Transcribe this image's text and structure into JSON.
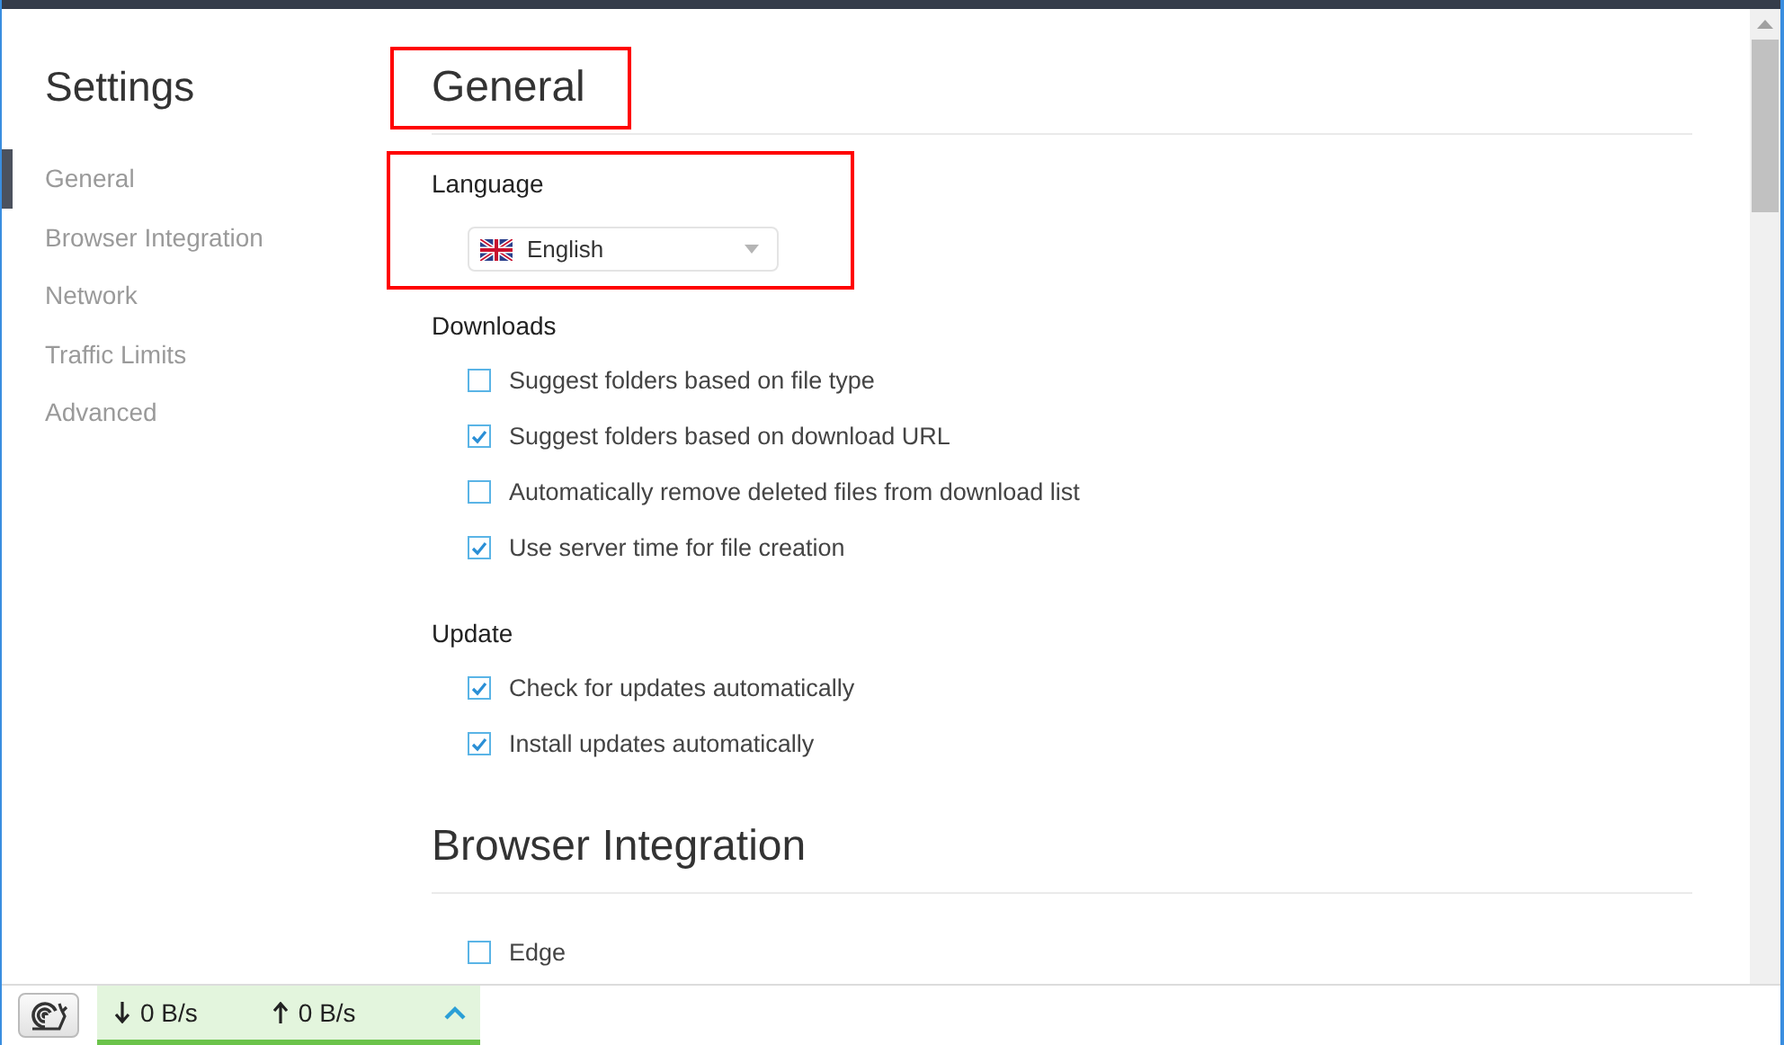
{
  "sidebar": {
    "title": "Settings",
    "items": [
      {
        "label": "General",
        "selected": true
      },
      {
        "label": "Browser Integration",
        "selected": false
      },
      {
        "label": "Network",
        "selected": false
      },
      {
        "label": "Traffic Limits",
        "selected": false
      },
      {
        "label": "Advanced",
        "selected": false
      }
    ]
  },
  "sections": [
    {
      "title": "General",
      "highlighted": true,
      "groups": [
        {
          "kind": "select",
          "label": "Language",
          "value": "English",
          "highlighted": true
        },
        {
          "kind": "checkboxes",
          "label": "Downloads",
          "highlighted": false,
          "options": [
            {
              "label": "Suggest folders based on file type",
              "checked": false
            },
            {
              "label": "Suggest folders based on download URL",
              "checked": true
            },
            {
              "label": "Automatically remove deleted files from download list",
              "checked": false
            },
            {
              "label": "Use server time for file creation",
              "checked": true
            }
          ]
        },
        {
          "kind": "checkboxes",
          "label": "Update",
          "highlighted": false,
          "options": [
            {
              "label": "Check for updates automatically",
              "checked": true
            },
            {
              "label": "Install updates automatically",
              "checked": true
            }
          ]
        }
      ]
    },
    {
      "title": "Browser Integration",
      "highlighted": false,
      "groups": [
        {
          "kind": "checkboxes",
          "highlighted": false,
          "options": [
            {
              "label": "Edge",
              "checked": false
            }
          ]
        }
      ]
    }
  ],
  "status_bar": {
    "download": "0 B/s",
    "upload": "0 B/s"
  }
}
